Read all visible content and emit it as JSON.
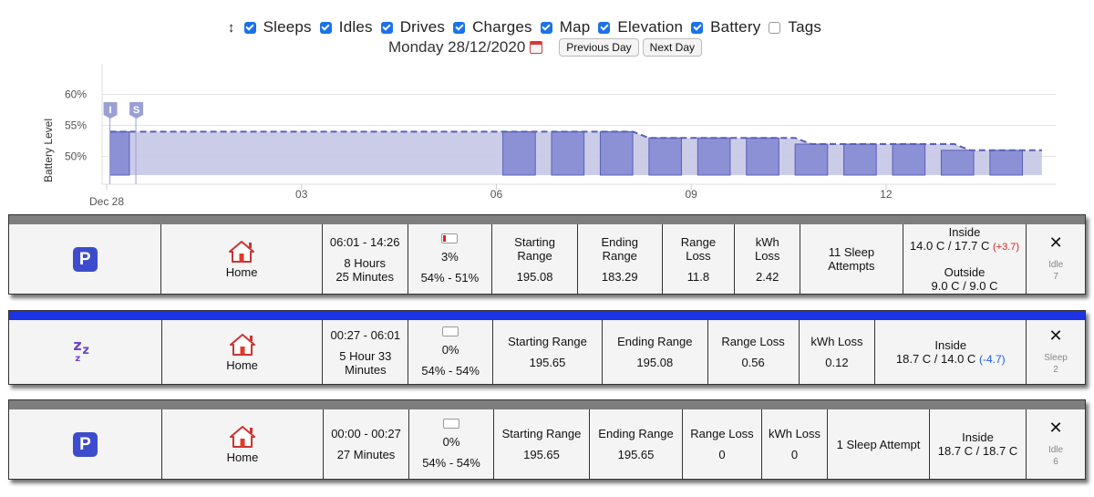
{
  "filters": [
    {
      "label": "Sleeps",
      "checked": true
    },
    {
      "label": "Idles",
      "checked": true
    },
    {
      "label": "Drives",
      "checked": true
    },
    {
      "label": "Charges",
      "checked": true
    },
    {
      "label": "Map",
      "checked": true
    },
    {
      "label": "Elevation",
      "checked": true
    },
    {
      "label": "Battery",
      "checked": true
    },
    {
      "label": "Tags",
      "checked": false
    }
  ],
  "toggle_glyph": "↕",
  "date": "Monday 28/12/2020",
  "prev_label": "Previous Day",
  "next_label": "Next Day",
  "chart_data": {
    "type": "area",
    "ylabel": "Battery Level",
    "y_ticks": [
      "60%",
      "55%",
      "50%"
    ],
    "x_ticks": [
      "Dec 28",
      "03",
      "06",
      "09",
      "12"
    ],
    "x_tick_hours": [
      0,
      3,
      6,
      9,
      12
    ],
    "ylim": [
      47,
      62
    ],
    "xlim_hours": [
      0,
      14.5
    ],
    "line": [
      [
        0.05,
        54
      ],
      [
        6.0,
        54
      ],
      [
        8.1,
        54
      ],
      [
        8.35,
        53
      ],
      [
        10.6,
        53
      ],
      [
        10.85,
        52
      ],
      [
        13.05,
        52
      ],
      [
        13.3,
        51
      ],
      [
        14.4,
        51
      ]
    ],
    "blocks": [
      {
        "start": 0.05,
        "end": 0.35,
        "value": 54
      },
      {
        "start": 6.1,
        "end": 6.6,
        "value": 54
      },
      {
        "start": 6.85,
        "end": 7.35,
        "value": 54
      },
      {
        "start": 7.6,
        "end": 8.1,
        "value": 54
      },
      {
        "start": 8.35,
        "end": 8.85,
        "value": 53
      },
      {
        "start": 9.1,
        "end": 9.6,
        "value": 53
      },
      {
        "start": 9.85,
        "end": 10.35,
        "value": 53
      },
      {
        "start": 10.6,
        "end": 11.1,
        "value": 52
      },
      {
        "start": 11.35,
        "end": 11.85,
        "value": 52
      },
      {
        "start": 12.1,
        "end": 12.6,
        "value": 52
      },
      {
        "start": 12.85,
        "end": 13.35,
        "value": 51
      },
      {
        "start": 13.6,
        "end": 14.1,
        "value": 51
      }
    ],
    "markers": [
      {
        "label": "I",
        "hour": 0.05
      },
      {
        "label": "S",
        "hour": 0.45
      }
    ],
    "grid": true
  },
  "cards": [
    {
      "kind": "idle",
      "time": "06:01 - 14:26",
      "duration": "8 Hours\n25 Minutes",
      "battery_pct": "3%",
      "battery_range": "54% - 51%",
      "location": "Home",
      "start_range_label": "Starting Range",
      "start_range": "195.08",
      "end_range_label": "Ending Range",
      "end_range": "183.29",
      "range_loss_label": "Range Loss",
      "range_loss": "11.8",
      "kwh_label": "kWh Loss",
      "kwh": "2.42",
      "attempts": "11 Sleep\nAttempts",
      "inside_label": "Inside",
      "inside_val": "14.0 C / 17.7 C",
      "inside_delta": "(+3.7)",
      "outside_label": "Outside",
      "outside_val": "9.0 C / 9.0 C",
      "type_label": "Idle",
      "type_num": "7"
    },
    {
      "kind": "sleep",
      "time": "00:27 - 06:01",
      "duration": "5 Hour 33\nMinutes",
      "battery_pct": "0%",
      "battery_range": "54% - 54%",
      "location": "Home",
      "start_range_label": "Starting Range",
      "start_range": "195.65",
      "end_range_label": "Ending Range",
      "end_range": "195.08",
      "range_loss_label": "Range Loss",
      "range_loss": "0.56",
      "kwh_label": "kWh Loss",
      "kwh": "0.12",
      "inside_label": "Inside",
      "inside_val": "18.7 C / 14.0 C",
      "inside_delta": "(-4.7)",
      "type_label": "Sleep",
      "type_num": "2"
    },
    {
      "kind": "idle",
      "time": "00:00 - 00:27",
      "duration": "27 Minutes",
      "battery_pct": "0%",
      "battery_range": "54% - 54%",
      "location": "Home",
      "start_range_label": "Starting Range",
      "start_range": "195.65",
      "end_range_label": "Ending Range",
      "end_range": "195.65",
      "range_loss_label": "Range Loss",
      "range_loss": "0",
      "kwh_label": "kWh Loss",
      "kwh": "0",
      "attempts": "1 Sleep Attempt",
      "inside_label": "Inside",
      "inside_val": "18.7 C / 18.7 C",
      "type_label": "Idle",
      "type_num": "6"
    }
  ],
  "icons": {
    "parked": "P",
    "home": "home-icon",
    "sleep": "Zz",
    "close": "✕"
  },
  "colors": {
    "accent": "#1a73e8",
    "chart_fill": "#c5c8e6",
    "chart_block": "#8c91d6",
    "chart_line": "#5a5fb8",
    "sleep_strip": "#1d33e6",
    "idle_strip": "#7e7e7e",
    "parked_badge": "#3d4ccc"
  }
}
